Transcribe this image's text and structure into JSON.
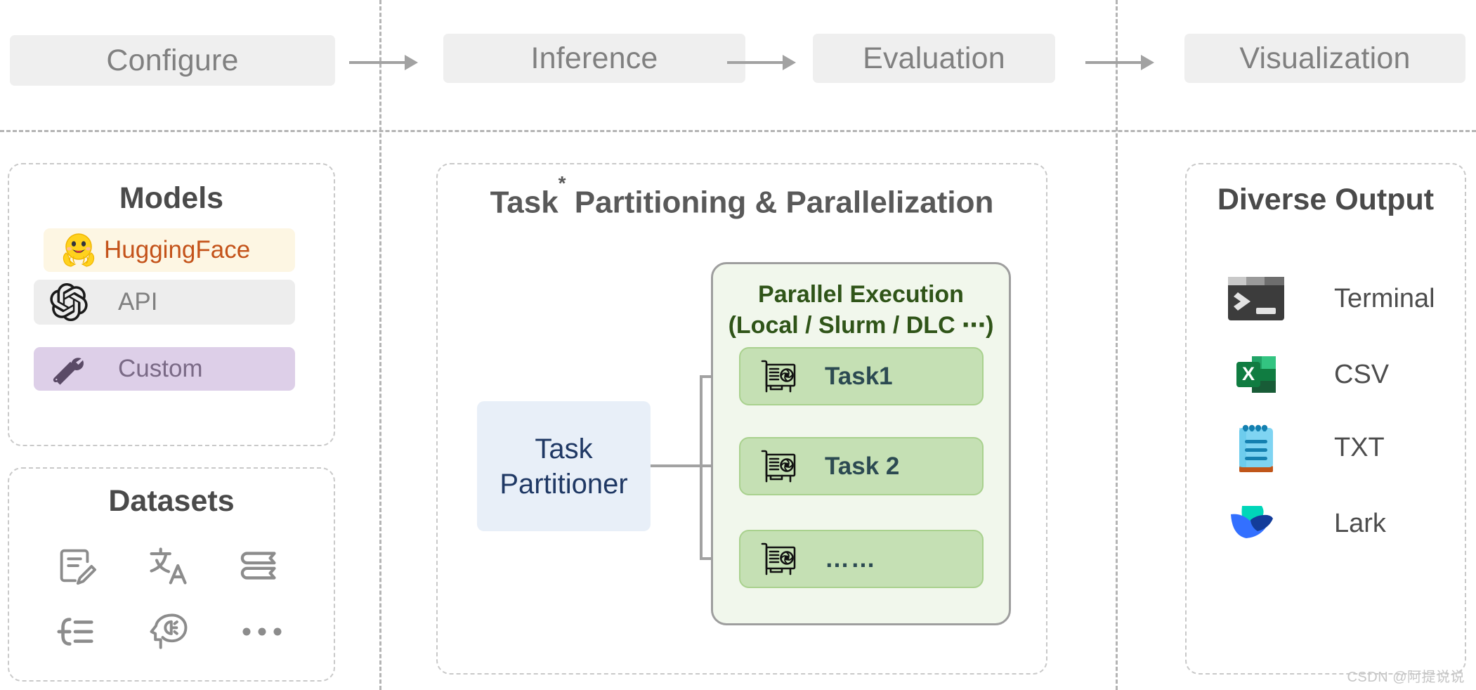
{
  "pipeline": {
    "stages": [
      {
        "label": "Configure"
      },
      {
        "label": "Inference"
      },
      {
        "label": "Evaluation"
      },
      {
        "label": "Visualization"
      }
    ],
    "arrow_icon": "arrow-right-icon"
  },
  "models_panel": {
    "title": "Models",
    "items": [
      {
        "label": "HuggingFace",
        "icon": "huggingface-icon",
        "bg": "#fdf6e3",
        "text_color": "#c4531a"
      },
      {
        "label": "API",
        "icon": "openai-icon",
        "bg": "#ededed",
        "text_color": "#808080"
      },
      {
        "label": "Custom",
        "icon": "tools-icon",
        "bg": "#ddcfe8",
        "text_color": "#7a6a86"
      }
    ]
  },
  "datasets_panel": {
    "title": "Datasets",
    "icons": [
      {
        "name": "note-edit-icon"
      },
      {
        "name": "translate-icon"
      },
      {
        "name": "book-icon"
      },
      {
        "name": "list-math-icon"
      },
      {
        "name": "brain-head-icon"
      },
      {
        "name": "ellipsis-icon"
      }
    ]
  },
  "center_panel": {
    "title_main": "Task",
    "title_sup": "*",
    "title_rest": " Partitioning & Parallelization",
    "partitioner": {
      "line1": "Task",
      "line2": "Partitioner"
    },
    "execution": {
      "title_line1": "Parallel Execution",
      "title_line2": "(Local / Slurm / DLC ⋯)",
      "tasks": [
        {
          "label": "Task1",
          "icon": "gpu-card-icon"
        },
        {
          "label": "Task 2",
          "icon": "gpu-card-icon"
        },
        {
          "label": "……",
          "icon": "gpu-card-icon"
        }
      ]
    }
  },
  "output_panel": {
    "title": "Diverse Output",
    "items": [
      {
        "label": "Terminal",
        "icon": "terminal-icon"
      },
      {
        "label": "CSV",
        "icon": "excel-icon"
      },
      {
        "label": "TXT",
        "icon": "notepad-icon"
      },
      {
        "label": "Lark",
        "icon": "lark-icon"
      }
    ]
  },
  "watermark": {
    "text": "CSDN @阿提说说"
  },
  "colors": {
    "stage_bg": "#efefef",
    "stage_text": "#808080",
    "dash_line": "#b4b4b4",
    "panel_border": "#c9c9c9",
    "exec_bg": "#f1f7ec",
    "exec_text": "#2f5418",
    "task_bg": "#c5e0b4",
    "task_text": "#2c4a52",
    "partitioner_bg": "#e8eff8",
    "partitioner_text": "#1f3864"
  }
}
